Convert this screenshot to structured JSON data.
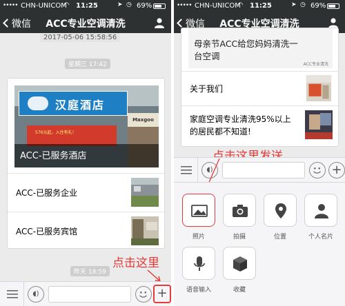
{
  "status_bar": {
    "signal": "•••••",
    "carrier": "CHN-UNICOM",
    "time": "11:25",
    "battery_percent": "69%",
    "battery_level": 0.69
  },
  "nav": {
    "back_label": "微信",
    "title": "ACC专业空调清洗"
  },
  "left": {
    "timestamp_partial": "2017-05-06 15:58:56",
    "date_pill": "星期三 17:42",
    "cover_sign_text": "汉庭酒店",
    "cover_shop_text": "Maxgoo",
    "cover_store_text": "576元起，入住有礼！",
    "cover_caption": "ACC-已服务酒店",
    "items": [
      {
        "label": "ACC-已服务企业"
      },
      {
        "label": "ACC-已服务宾馆"
      }
    ],
    "bottom_pill": "昨天 18:59",
    "annotation": "点击这里"
  },
  "right": {
    "banner_line1": "母亲节ACC给您妈妈清洗一",
    "banner_line2": "台空调",
    "banner_small": "ACC专业清洗",
    "items": [
      {
        "label": "关于我们"
      },
      {
        "label_line1": "家庭空调专业清洗95%以上",
        "label_line2": "的居民都不知道!"
      }
    ],
    "annotation": "点击这里发送",
    "tiles": [
      {
        "label": "照片",
        "icon": "photo-icon"
      },
      {
        "label": "拍摄",
        "icon": "camera-icon"
      },
      {
        "label": "位置",
        "icon": "location-icon"
      },
      {
        "label": "个人名片",
        "icon": "contact-card-icon"
      },
      {
        "label": "语音输入",
        "icon": "microphone-icon"
      },
      {
        "label": "收藏",
        "icon": "favorites-box-icon"
      }
    ]
  },
  "colors": {
    "nav_bg": "#2e3132",
    "chat_bg": "#ebebeb",
    "annotation_red": "#e53a3a"
  }
}
